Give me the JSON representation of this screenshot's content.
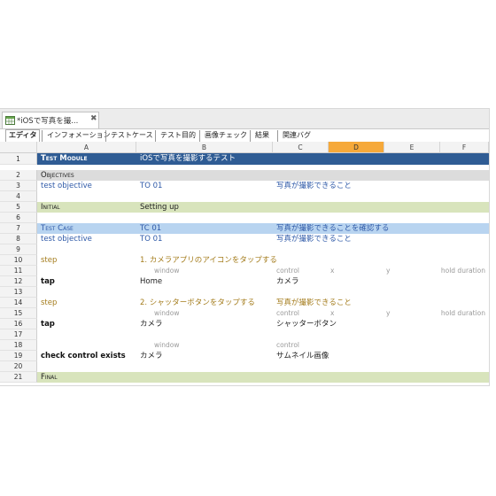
{
  "doc_tab": {
    "title": "*iOSで写真を撮...",
    "close": "✖"
  },
  "subtabs": [
    "エディタ",
    "インフォメーション",
    "テストケース",
    "テスト目的",
    "画像チェック",
    "結果",
    "関連バグ"
  ],
  "columns": [
    "A",
    "B",
    "C",
    "D",
    "E",
    "F"
  ],
  "rows": [
    {
      "n": "1",
      "a": "Test Module",
      "b": "iOSで写真を撮影するテスト",
      "c": "",
      "d": "",
      "e": "",
      "f": ""
    },
    {
      "n": "2",
      "a": "Objectives",
      "b": "",
      "c": "",
      "d": "",
      "e": "",
      "f": ""
    },
    {
      "n": "3",
      "a": "test objective",
      "b": "TO 01",
      "c": "写真が撮影できること",
      "d": "",
      "e": "",
      "f": ""
    },
    {
      "n": "4",
      "a": "",
      "b": "",
      "c": "",
      "d": "",
      "e": "",
      "f": ""
    },
    {
      "n": "5",
      "a": "Initial",
      "b": "Setting up",
      "c": "",
      "d": "",
      "e": "",
      "f": ""
    },
    {
      "n": "6",
      "a": "",
      "b": "",
      "c": "",
      "d": "",
      "e": "",
      "f": ""
    },
    {
      "n": "7",
      "a": "Test Case",
      "b": "TC 01",
      "c": "写真が撮影できることを確認する",
      "d": "",
      "e": "",
      "f": ""
    },
    {
      "n": "8",
      "a": "test objective",
      "b": "TO 01",
      "c": "写真が撮影できること",
      "d": "",
      "e": "",
      "f": ""
    },
    {
      "n": "9",
      "a": "",
      "b": "",
      "c": "",
      "d": "",
      "e": "",
      "f": ""
    },
    {
      "n": "10",
      "a": "step",
      "b": "1. カメラアプリのアイコンをタップする",
      "c": "",
      "d": "",
      "e": "",
      "f": ""
    },
    {
      "n": "11",
      "a": "",
      "b": "window",
      "c": "control",
      "d": "x",
      "e": "y",
      "f": "hold duration"
    },
    {
      "n": "12",
      "a": "tap",
      "b": "Home",
      "c": "カメラ",
      "d": "",
      "e": "",
      "f": ""
    },
    {
      "n": "13",
      "a": "",
      "b": "",
      "c": "",
      "d": "",
      "e": "",
      "f": ""
    },
    {
      "n": "14",
      "a": "step",
      "b": "2. シャッターボタンをタップする",
      "c": "写真が撮影できること",
      "d": "",
      "e": "",
      "f": ""
    },
    {
      "n": "15",
      "a": "",
      "b": "window",
      "c": "control",
      "d": "x",
      "e": "y",
      "f": "hold duration"
    },
    {
      "n": "16",
      "a": "tap",
      "b": "カメラ",
      "c": "シャッターボタン",
      "d": "",
      "e": "",
      "f": ""
    },
    {
      "n": "17",
      "a": "",
      "b": "",
      "c": "",
      "d": "",
      "e": "",
      "f": ""
    },
    {
      "n": "18",
      "a": "",
      "b": "window",
      "c": "control",
      "d": "",
      "e": "",
      "f": ""
    },
    {
      "n": "19",
      "a": "check control exists",
      "b": "カメラ",
      "c": "サムネイル画像",
      "d": "",
      "e": "",
      "f": ""
    },
    {
      "n": "20",
      "a": "",
      "b": "",
      "c": "",
      "d": "",
      "e": "",
      "f": ""
    },
    {
      "n": "21",
      "a": "Final",
      "b": "",
      "c": "",
      "d": "",
      "e": "",
      "f": ""
    }
  ],
  "colors": {
    "header_dark": "#2f5c94",
    "objectives_gray": "#dcdcdc",
    "initial_green": "#d8e4bc",
    "testcase_blue": "#b8d4f0",
    "selected_col": "#f6a93a"
  }
}
